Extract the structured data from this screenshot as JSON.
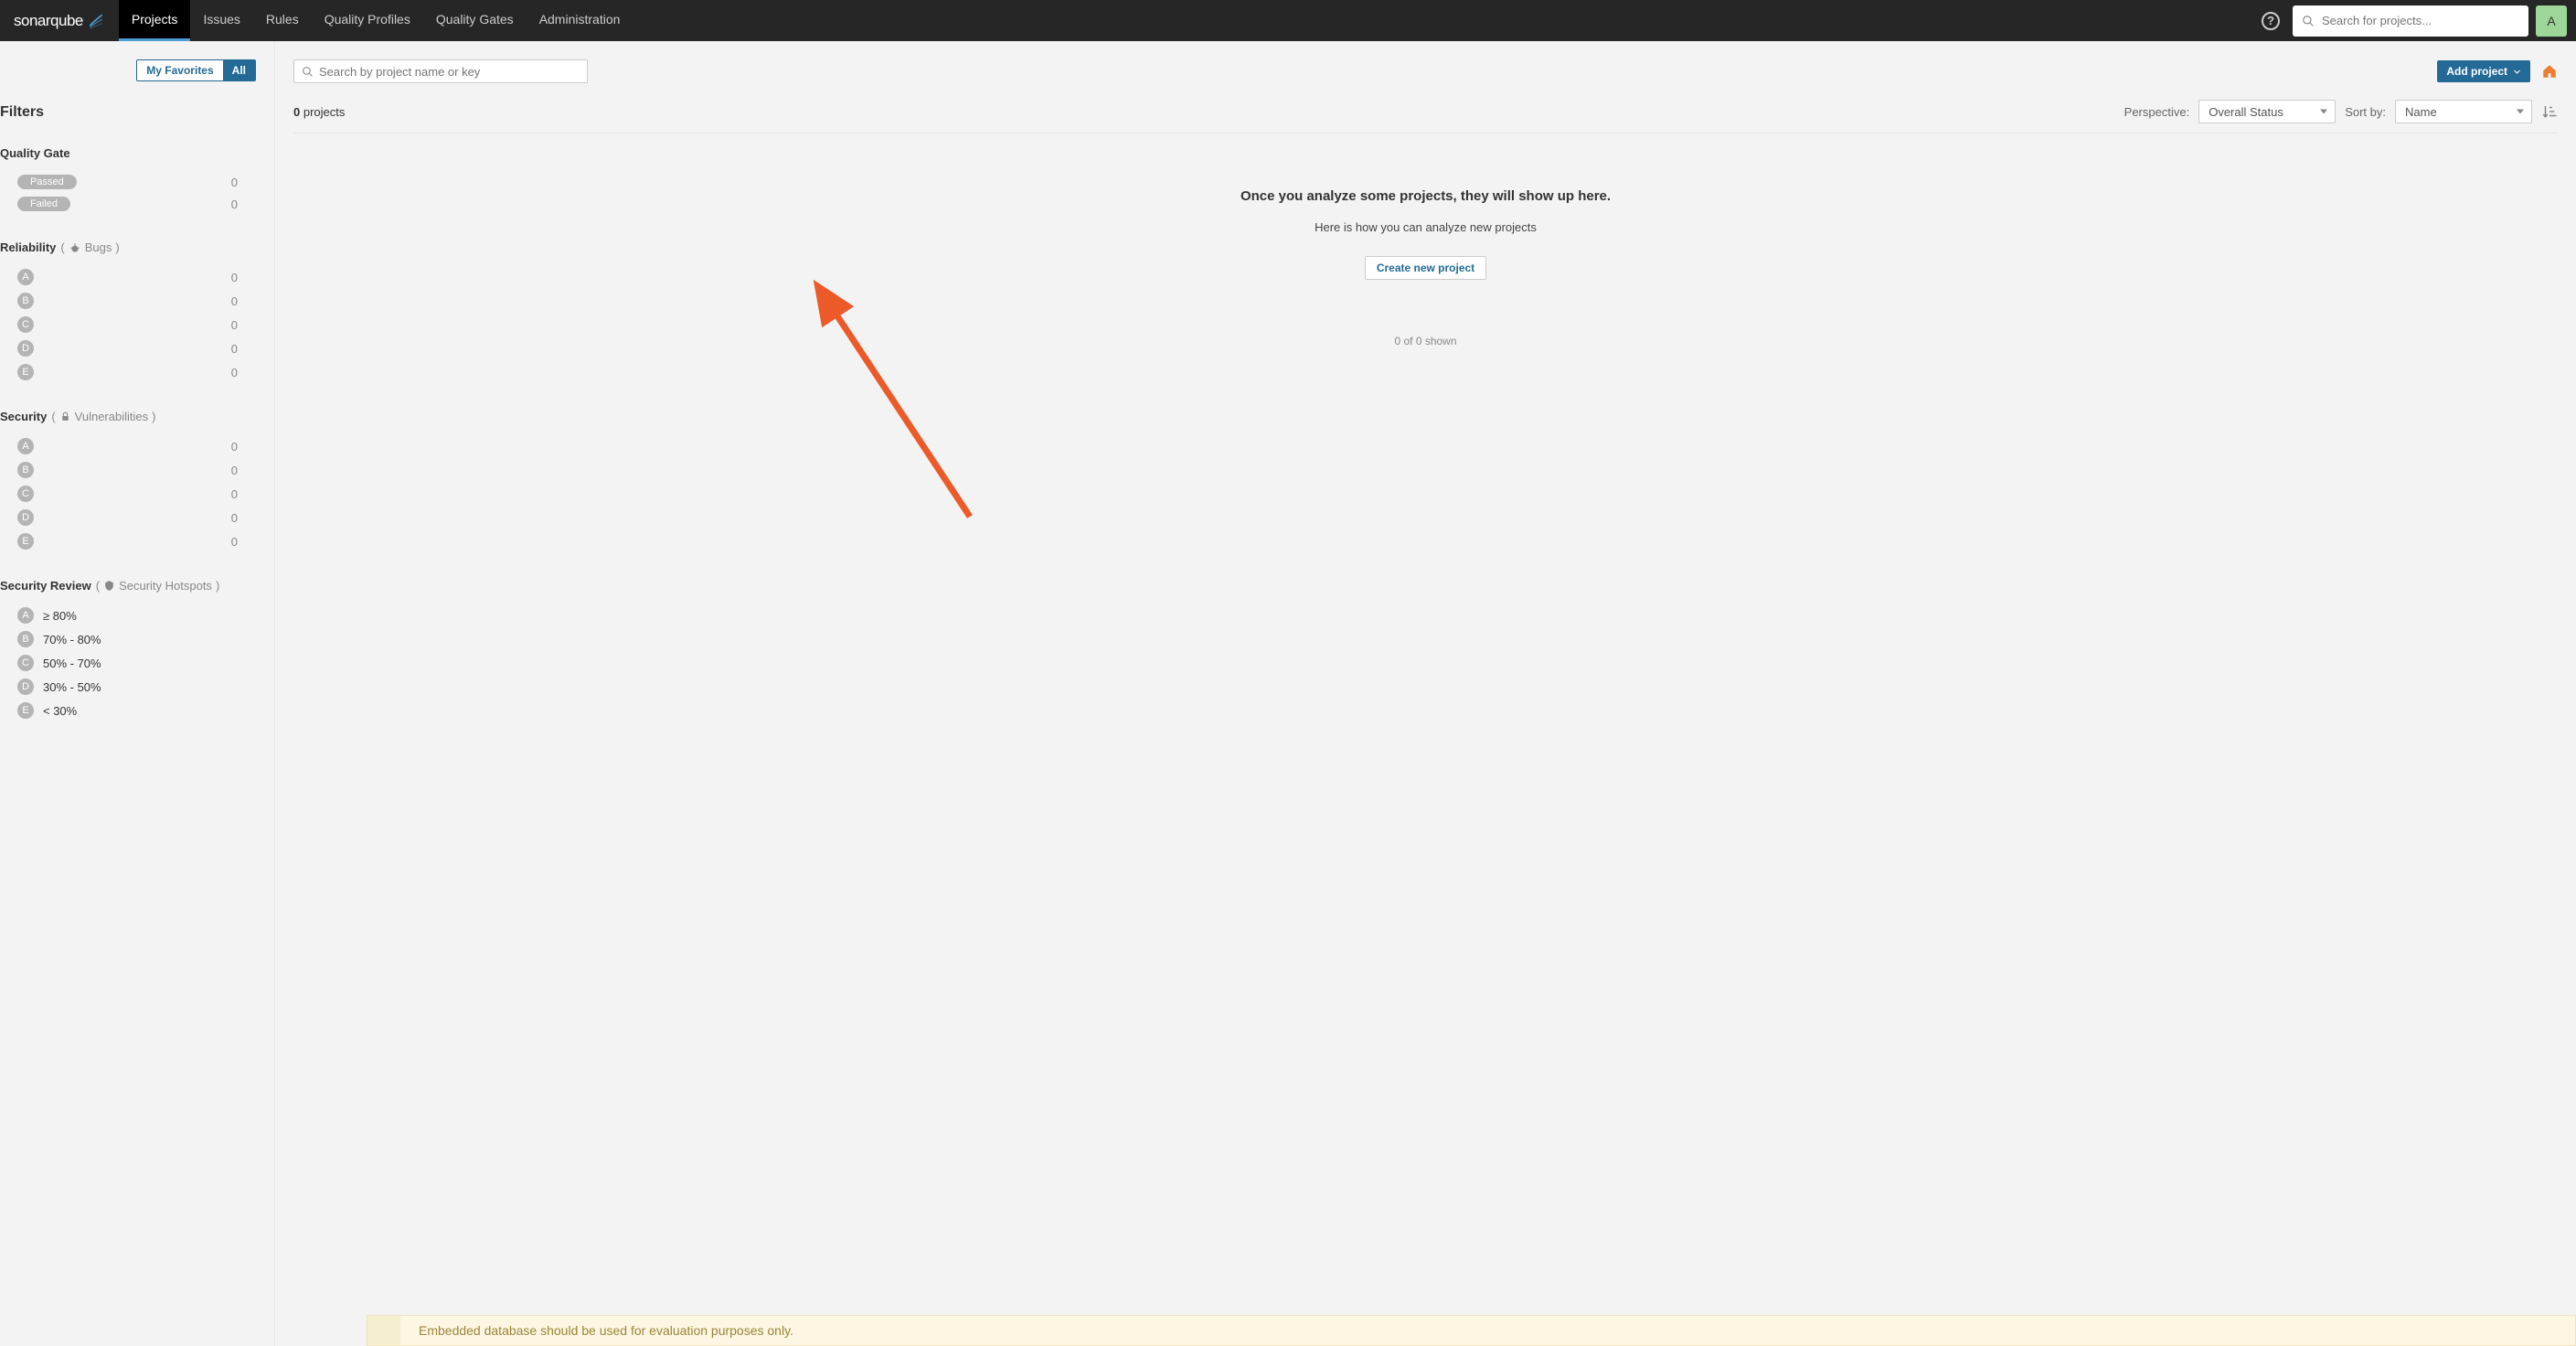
{
  "brand": {
    "name_a": "sonar",
    "name_b": "qube"
  },
  "nav": {
    "projects": "Projects",
    "issues": "Issues",
    "rules": "Rules",
    "quality_profiles": "Quality Profiles",
    "quality_gates": "Quality Gates",
    "administration": "Administration"
  },
  "global_search_placeholder": "Search for projects...",
  "avatar_letter": "A",
  "fav_toggle": {
    "favorites": "My Favorites",
    "all": "All"
  },
  "filters_title": "Filters",
  "quality_gate": {
    "title": "Quality Gate",
    "rows": [
      {
        "label": "Passed",
        "count": "0"
      },
      {
        "label": "Failed",
        "count": "0"
      }
    ]
  },
  "reliability": {
    "title": "Reliability",
    "sub": "Bugs",
    "rows": [
      {
        "badge": "A",
        "count": "0"
      },
      {
        "badge": "B",
        "count": "0"
      },
      {
        "badge": "C",
        "count": "0"
      },
      {
        "badge": "D",
        "count": "0"
      },
      {
        "badge": "E",
        "count": "0"
      }
    ]
  },
  "security": {
    "title": "Security",
    "sub": "Vulnerabilities",
    "rows": [
      {
        "badge": "A",
        "count": "0"
      },
      {
        "badge": "B",
        "count": "0"
      },
      {
        "badge": "C",
        "count": "0"
      },
      {
        "badge": "D",
        "count": "0"
      },
      {
        "badge": "E",
        "count": "0"
      }
    ]
  },
  "security_review": {
    "title": "Security Review",
    "sub": "Security Hotspots",
    "rows": [
      {
        "badge": "A",
        "label": "≥ 80%"
      },
      {
        "badge": "B",
        "label": "70% - 80%"
      },
      {
        "badge": "C",
        "label": "50% - 70%"
      },
      {
        "badge": "D",
        "label": "30% - 50%"
      },
      {
        "badge": "E",
        "label": "< 30%"
      }
    ]
  },
  "project_search_placeholder": "Search by project name or key",
  "add_project_label": "Add project",
  "project_count": {
    "num": "0",
    "word": "projects"
  },
  "perspective": {
    "label": "Perspective:",
    "value": "Overall Status"
  },
  "sortby": {
    "label": "Sort by:",
    "value": "Name"
  },
  "empty": {
    "title": "Once you analyze some projects, they will show up here.",
    "sub": "Here is how you can analyze new projects",
    "button": "Create new project"
  },
  "shown_text": "0 of 0 shown",
  "banner_text": "Embedded database should be used for evaluation purposes only."
}
